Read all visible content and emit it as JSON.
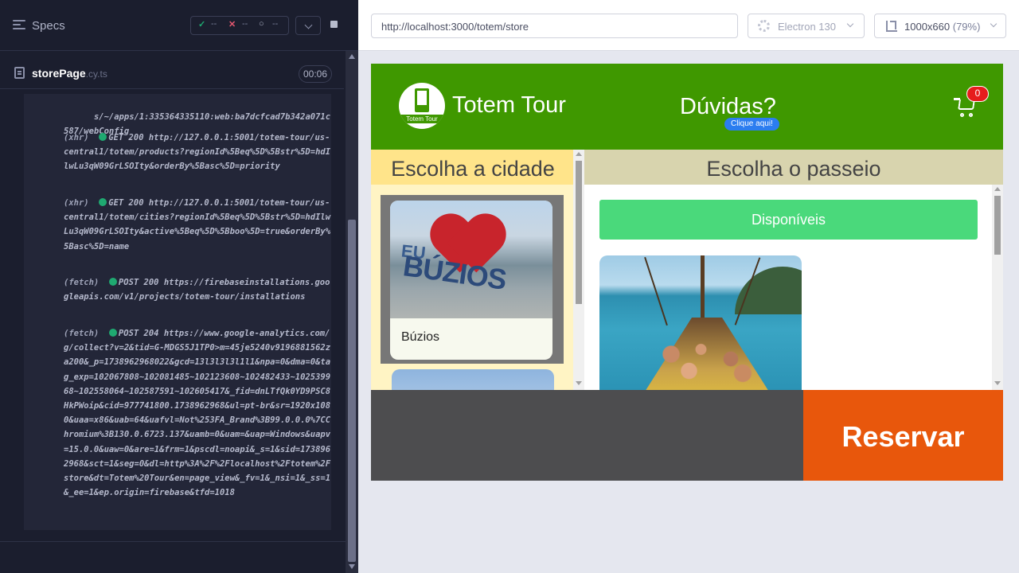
{
  "runner": {
    "specs_label": "Specs",
    "stats": {
      "passed": "--",
      "failed": "--",
      "pending": "--"
    },
    "spec": {
      "name": "storePage",
      "ext": ".cy.ts",
      "duration": "00:06"
    },
    "log": [
      {
        "tag": "",
        "status": "",
        "text": "s/~/apps/1:335364335110:web:ba7dcfcad7b342a071c587/webConfig"
      },
      {
        "tag": "(xhr)",
        "status": "GET 200",
        "text": "http://127.0.0.1:5001/totem-tour/us-central1/totem/products?regionId%5Beq%5D%5Bstr%5D=hdIlwLu3qW09GrLSOIty&orderBy%5Basc%5D=priority"
      },
      {
        "tag": "(xhr)",
        "status": "GET 200",
        "text": "http://127.0.0.1:5001/totem-tour/us-central1/totem/cities?regionId%5Beq%5D%5Bstr%5D=hdIlwLu3qW09GrLSOIty&active%5Beq%5D%5Bboo%5D=true&orderBy%5Basc%5D=name"
      },
      {
        "tag": "(fetch)",
        "status": "POST 200",
        "text": "https://firebaseinstallations.googleapis.com/v1/projects/totem-tour/installations"
      },
      {
        "tag": "(fetch)",
        "status": "POST 204",
        "text": "https://www.google-analytics.com/g/collect?v=2&tid=G-MDGS5J1TP0>m=45je5240v9196881562za200&_p=1738962968022&gcd=13l3l3l3l1l1&npa=0&dma=0&tag_exp=102067808~102081485~102123608~102482433~102539968~102558064~102587591~102605417&_fid=dnLTfQk0YD9PSC8HkPWoip&cid=977741800.1738962968&ul=pt-br&sr=1920x1080&uaa=x86&uab=64&uafvl=Not%253FA_Brand%3B99.0.0.0%7CChromium%3B130.0.6723.137&uamb=0&uam=&uap=Windows&uapv=15.0.0&uaw=0&are=1&frm=1&pscdl=noapi&_s=1&sid=1738962968&sct=1&seg=0&dl=http%3A%2F%2Flocalhost%2Ftotem%2Fstore&dt=Totem%20Tour&en=page_view&_fv=1&_nsi=1&_ss=1&_ee=1&ep.origin=firebase&tfd=1018"
      }
    ]
  },
  "browser": {
    "url": "http://localhost:3000/totem/store",
    "engine": "Electron 130",
    "viewport": "1000x660",
    "zoom": "(79%)"
  },
  "app": {
    "logo_text": "Totem Tour",
    "brand": "Totem Tour",
    "faq": "Dúvidas?",
    "faq_pill": "Clique aqui!",
    "cart_count": "0",
    "cities_title": "Escolha a cidade",
    "city_image_text": {
      "top": "EU",
      "bottom": "BÚZIOS"
    },
    "cities": [
      {
        "name": "Búzios"
      }
    ],
    "tours_title": "Escolha o passeio",
    "available_label": "Disponíveis",
    "reserve_label": "Reservar"
  },
  "colors": {
    "header_green": "#3f9800",
    "cities_bg": "#fff4c4",
    "cities_title_bg": "#ffe48a",
    "tours_title_bg": "#d8d4ae",
    "available_green": "#4ad97b",
    "reserve_orange": "#e8570c",
    "footer_gray": "#4d4d4f",
    "cart_badge_red": "#e61c1c",
    "faq_pill_blue": "#2b7df0"
  }
}
